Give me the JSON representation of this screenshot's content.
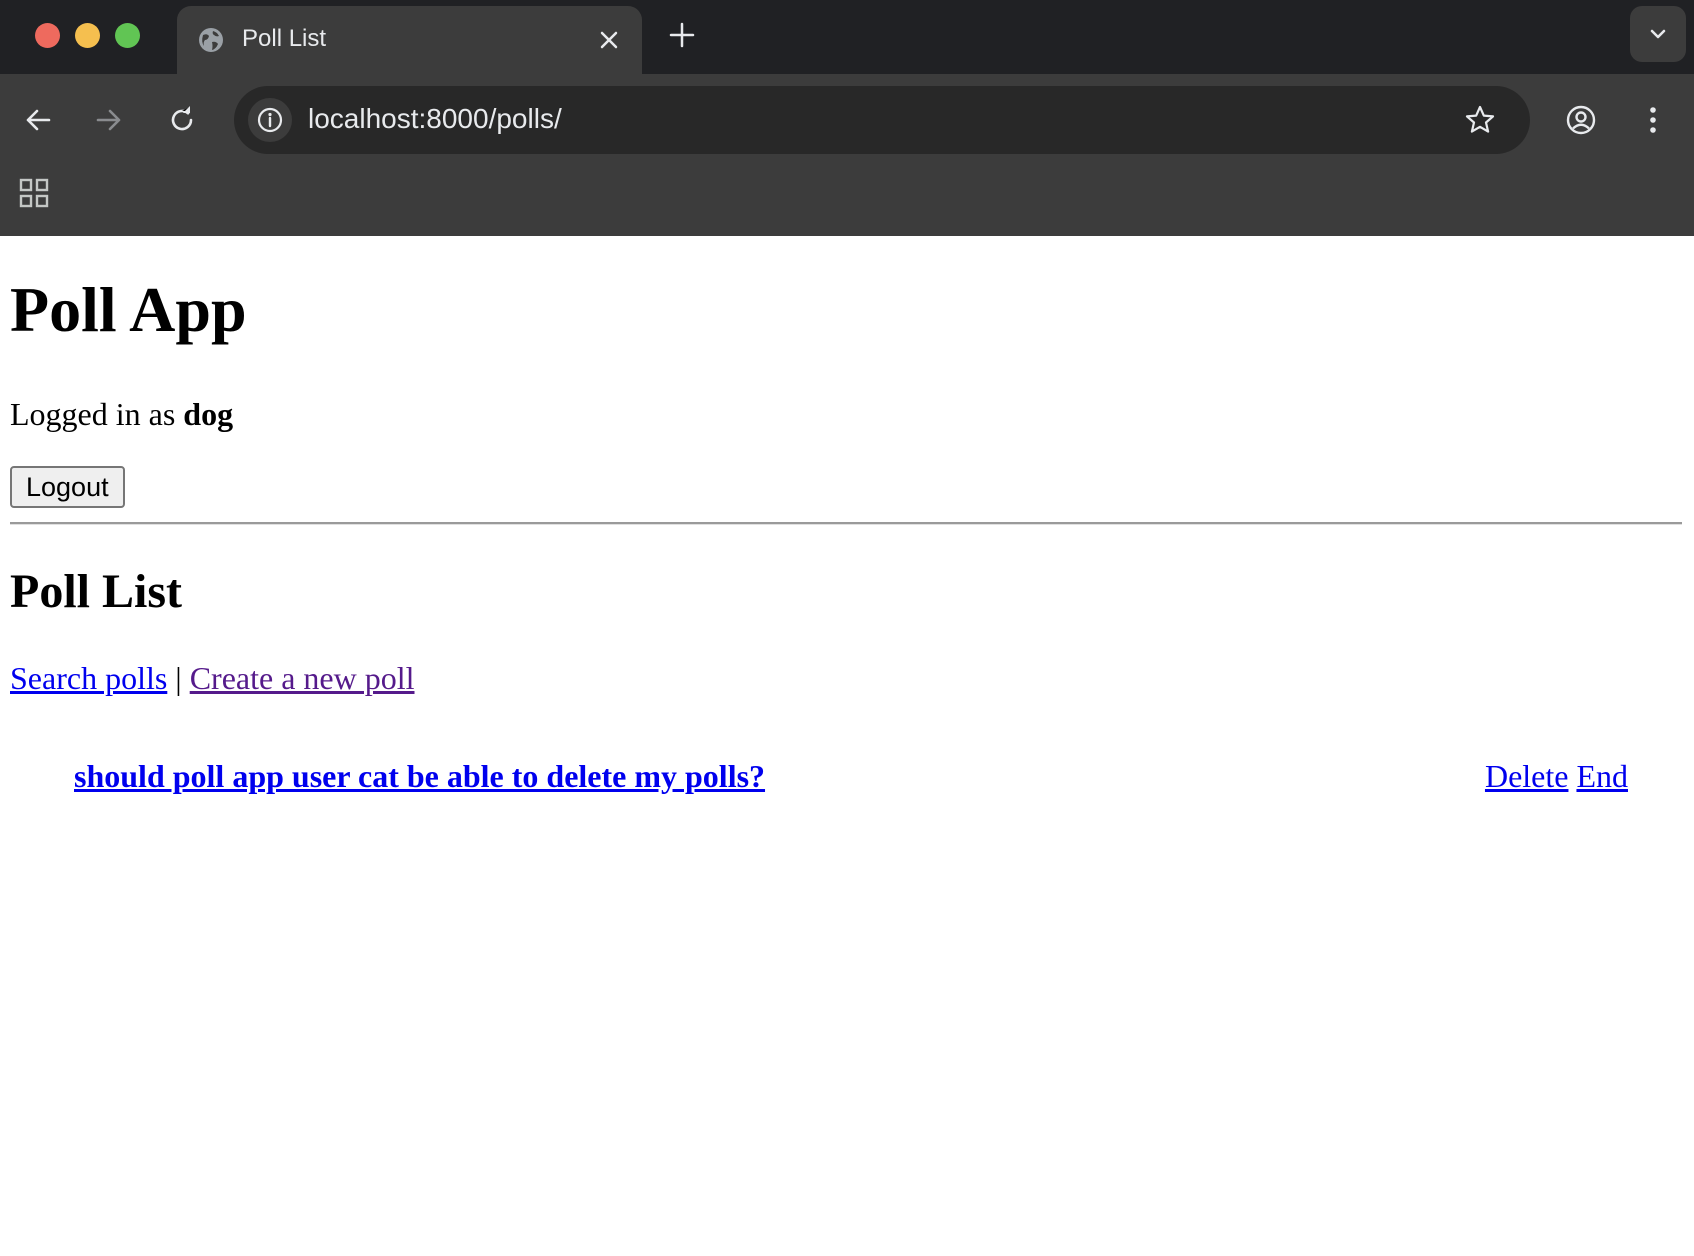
{
  "browser": {
    "tab_title": "Poll List",
    "url": "localhost:8000/polls/"
  },
  "page": {
    "app_title": "Poll App",
    "logged_in_prefix": "Logged in as",
    "username": "dog",
    "logout_label": "Logout",
    "section_title": "Poll List",
    "search_link": "Search polls",
    "link_separator": "|",
    "create_link": "Create a new poll",
    "polls": [
      {
        "question": "should poll app user cat be able to delete my polls?",
        "delete_label": "Delete",
        "end_label": "End"
      }
    ]
  },
  "colors": {
    "link": "#0000ee",
    "visited_link": "#551a8b",
    "chrome_dark": "#202124",
    "chrome_toolbar": "#3c3c3c"
  }
}
